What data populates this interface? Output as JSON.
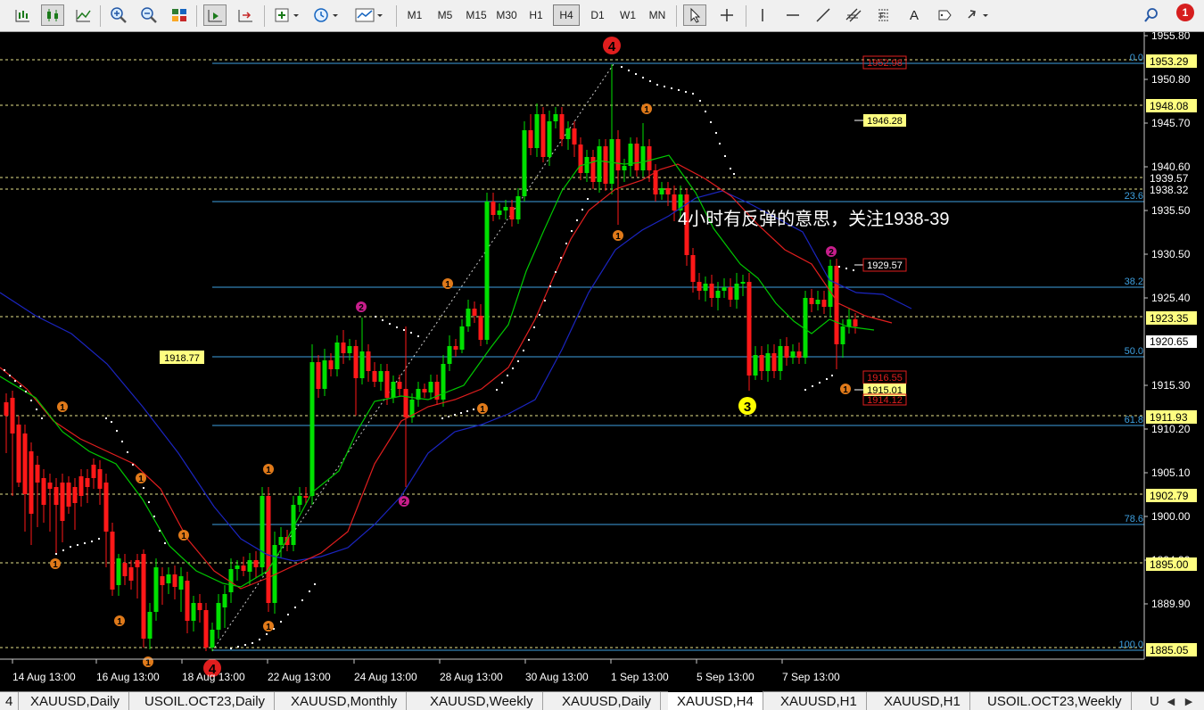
{
  "toolbar": {
    "timeframes": [
      "M1",
      "M5",
      "M15",
      "M30",
      "H1",
      "H4",
      "D1",
      "W1",
      "MN"
    ],
    "active_timeframe": "H4",
    "draw_text_tool": "A",
    "notification_count": "1"
  },
  "chart": {
    "annotation": "4小时有反弹的意思，关注1938-39",
    "price_axis_labels": [
      "1955.80",
      "1950.80",
      "1945.70",
      "1940.60",
      "1935.50",
      "1930.50",
      "1925.40",
      "1920.65",
      "1915.30",
      "1910.20",
      "1905.10",
      "1900.00",
      "1894.90",
      "1889.90"
    ],
    "time_axis_labels": [
      "14 Aug 13:00",
      "16 Aug 13:00",
      "18 Aug 13:00",
      "22 Aug 13:00",
      "24 Aug 13:00",
      "28 Aug 13:00",
      "30 Aug 13:00",
      "1 Sep 13:00",
      "5 Sep 13:00",
      "7 Sep 13:00"
    ],
    "horizontal_lines": [
      "1953.29",
      "1948.08",
      "1939.57",
      "1938.32",
      "1923.35",
      "1911.93",
      "1902.79",
      "1895.00",
      "1885.05"
    ],
    "fib_levels": [
      "0.0",
      "23.6",
      "38.2",
      "50.0",
      "61.8",
      "78.6",
      "100.0"
    ],
    "left_level_label": "1918.77",
    "box_labels_yellow": [
      "1946.28",
      "1915.01"
    ],
    "box_labels_red": [
      "1952.98",
      "1929.57",
      "1916.55",
      "1914.12"
    ],
    "price_label_plain": "1920.65",
    "wave_labels_big": [
      "4",
      "3"
    ],
    "wave_labels_small": [
      "1",
      "2"
    ]
  },
  "tabs": [
    {
      "label": "4",
      "active": false
    },
    {
      "label": "XAUUSD,Daily",
      "active": false
    },
    {
      "label": "USOIL.OCT23,Daily",
      "active": false
    },
    {
      "label": "XAUUSD,Monthly",
      "active": false
    },
    {
      "label": "XAUUSD,Weekly",
      "active": false
    },
    {
      "label": "XAUUSD,Daily",
      "active": false
    },
    {
      "label": "XAUUSD,H4",
      "active": true
    },
    {
      "label": "XAUUSD,H1",
      "active": false
    },
    {
      "label": "XAUUSD,H1",
      "active": false
    },
    {
      "label": "USOIL.OCT23,Weekly",
      "active": false
    },
    {
      "label": "U",
      "active": false
    }
  ],
  "colors": {
    "bull_candle": "#00e000",
    "bear_candle": "#ff1818",
    "ma_fast": "#00c800",
    "ma_mid": "#e01e1e",
    "ma_slow": "#1b25c0",
    "level_line": "#e6e28a",
    "fib_line": "#3ea0e0",
    "label_yellow": "#ffff80",
    "label_red": "#e01e1e"
  }
}
